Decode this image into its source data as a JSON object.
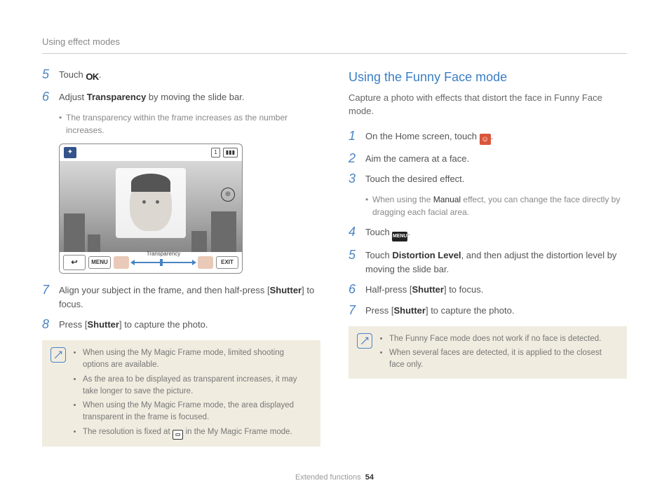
{
  "header": {
    "title": "Using effect modes"
  },
  "footer": {
    "section": "Extended functions",
    "page": "54"
  },
  "left": {
    "step5": {
      "num": "5",
      "pre": "Touch ",
      "post": "."
    },
    "step6": {
      "num": "6",
      "pre": "Adjust ",
      "bold": "Transparency",
      "post": " by moving the slide bar.",
      "bullet": "The transparency within the frame increases as the number increases."
    },
    "screenshot": {
      "count": "1",
      "menu": "MENU",
      "exit": "EXIT",
      "slider_label": "Transparency",
      "back": "↩"
    },
    "step7": {
      "num": "7",
      "pre": "Align your subject in the frame, and then half-press [",
      "bold": "Shutter",
      "post": "] to focus."
    },
    "step8": {
      "num": "8",
      "pre": "Press [",
      "bold": "Shutter",
      "post": "] to capture the photo."
    },
    "note": {
      "b1": "When using the My Magic Frame mode, limited shooting options are available.",
      "b2": "As the area to be displayed as transparent increases, it may take longer to save the picture.",
      "b3": "When using the My Magic Frame mode, the area displayed transparent in the frame is focused.",
      "b4_pre": "The resolution is fixed at ",
      "b4_post": " in the My Magic Frame mode."
    }
  },
  "right": {
    "title": "Using the Funny Face mode",
    "desc": "Capture a photo with effects that distort the face in Funny Face mode.",
    "step1": {
      "num": "1",
      "pre": "On the Home screen, touch ",
      "post": "."
    },
    "step2": {
      "num": "2",
      "text": "Aim the camera at a face."
    },
    "step3": {
      "num": "3",
      "text": "Touch the desired effect.",
      "bullet_pre": "When using the ",
      "bullet_bold": "Manual",
      "bullet_post": " effect, you can change the face directly by dragging each facial area."
    },
    "step4": {
      "num": "4",
      "pre": "Touch ",
      "post": "."
    },
    "step5": {
      "num": "5",
      "pre": "Touch ",
      "bold": "Distortion Level",
      "post": ", and then adjust the distortion level by moving the slide bar."
    },
    "step6": {
      "num": "6",
      "pre": "Half-press [",
      "bold": "Shutter",
      "post": "] to focus."
    },
    "step7": {
      "num": "7",
      "pre": "Press [",
      "bold": "Shutter",
      "post": "] to capture the photo."
    },
    "note": {
      "b1": "The Funny Face mode does not work if no face is detected.",
      "b2": "When several faces are detected, it is applied to the closest face only."
    }
  }
}
